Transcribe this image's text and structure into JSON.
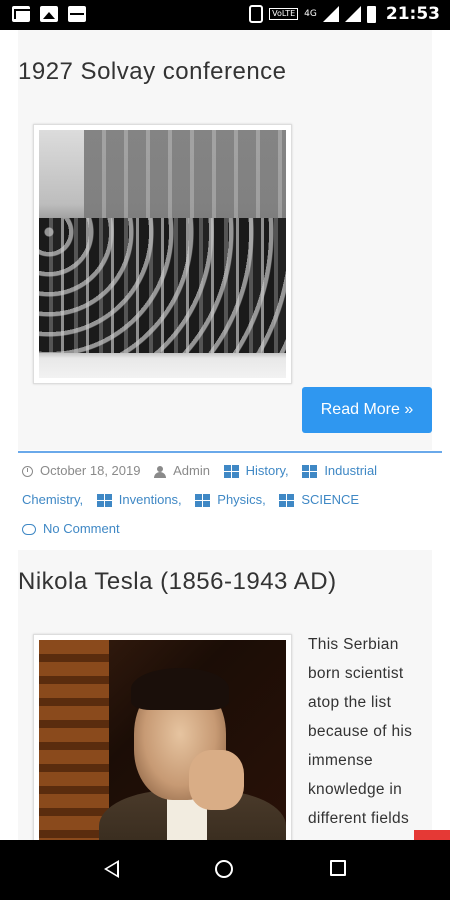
{
  "status_bar": {
    "time": "21:53",
    "network": "4G",
    "volte": "VoLTE",
    "icons": [
      "mail-icon",
      "image-icon",
      "pulse-icon",
      "vibrate-icon",
      "signal-icon",
      "battery-icon"
    ]
  },
  "post1": {
    "title": "1927 Solvay conference",
    "read_more": "Read More »",
    "meta": {
      "date": "October 18, 2019",
      "author": "Admin",
      "categories": [
        "History,",
        "Industrial Chemistry,",
        "Inventions,",
        "Physics,",
        "SCIENCE"
      ],
      "comments": "No Comment"
    }
  },
  "post2": {
    "title": "Nikola Tesla (1856-1943 AD)",
    "excerpt_lines": [
      "This Serbian",
      "born scientist",
      "atop the list",
      "because of his",
      "immense",
      "knowledge in",
      "different fields"
    ]
  },
  "colors": {
    "accent": "#2f97f0",
    "link": "#3f88c5",
    "divider": "#6aa9ea",
    "card_bg": "#f7f7f7"
  }
}
